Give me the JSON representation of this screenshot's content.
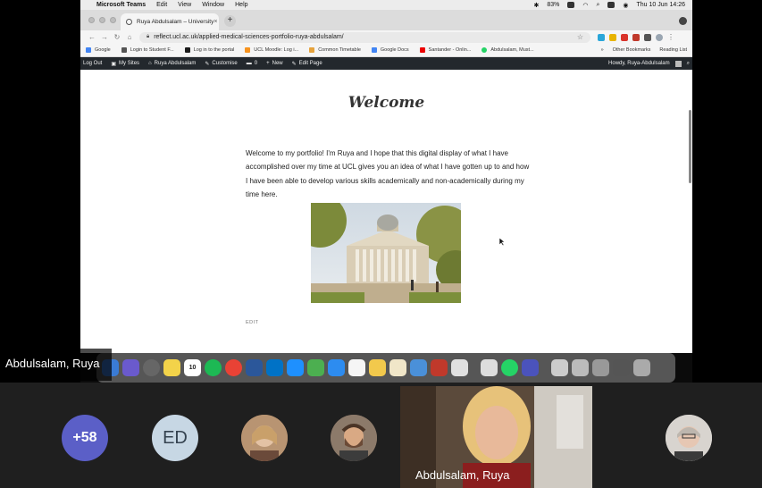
{
  "menubar": {
    "app": "Microsoft Teams",
    "items": [
      "Edit",
      "View",
      "Window",
      "Help"
    ],
    "battery": "83%",
    "clock": "Thu 10 Jun  14:26"
  },
  "browser": {
    "tab_title": "Ruya Abdulsalam – University",
    "url": "reflect.ucl.ac.uk/applied-medical-sciences-portfolio-ruya-abdulsalam/",
    "bookmarks": [
      "Google",
      "Login to Student F...",
      "Log in to the portal",
      "UCL Moodle: Log i...",
      "Common Timetable",
      "Google Docs",
      "Santander - Onlin...",
      "Abdulsalam, Must..."
    ],
    "other_bookmarks": "Other Bookmarks",
    "reading_list": "Reading List"
  },
  "wp_admin": {
    "logout": "Log Out",
    "my_sites": "My Sites",
    "site_name": "Ruya Abdulsalam",
    "customise": "Customise",
    "comments": "0",
    "new": "New",
    "edit_page": "Edit Page",
    "howdy": "Howdy, Ruya-Abdulsalam"
  },
  "page": {
    "title": "Welcome",
    "intro": "Welcome to my portfolio! I'm Ruya and I hope that this digital display of what I have accomplished over my time at UCL gives you an idea of what I have gotten up to and how I have been able to develop various skills academically and non-academically during my time here.",
    "edit_link": "EDIT"
  },
  "dock": {
    "calendar_day": "10"
  },
  "teams": {
    "screen_sharer": "Abdulsalam, Ruya",
    "overflow_count": "+58",
    "initials": "ED",
    "video_name": "Abdulsalam, Ruya",
    "colors": {
      "overflow": "#5b5fc7",
      "initials_bg": "#c7d7e4"
    }
  }
}
